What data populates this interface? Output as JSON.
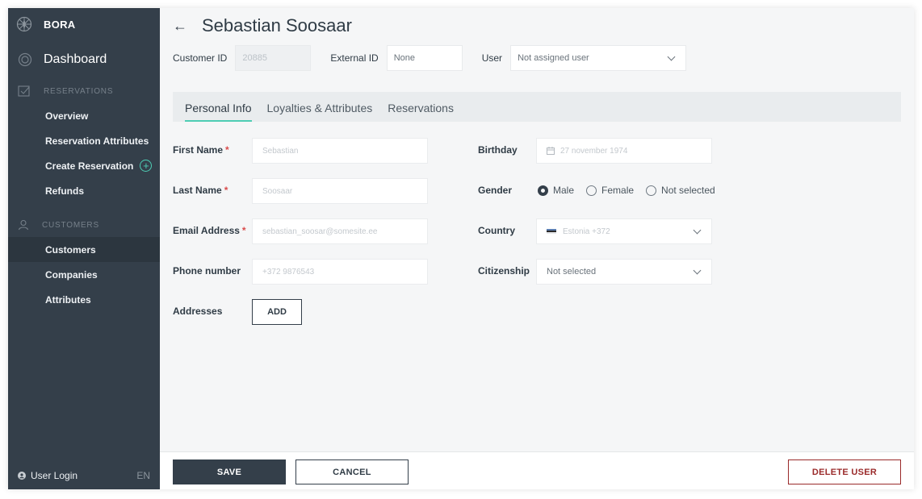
{
  "app": {
    "brand": "BORA"
  },
  "sidebar": {
    "dashboard": "Dashboard",
    "reservations_section": "RESERVATIONS",
    "reservation_items": [
      {
        "label": "Overview"
      },
      {
        "label": "Reservation Attributes"
      },
      {
        "label": "Create Reservation"
      },
      {
        "label": "Refunds"
      }
    ],
    "customers_section": "CUSTOMERS",
    "customer_items": [
      {
        "label": "Customers"
      },
      {
        "label": "Companies"
      },
      {
        "label": "Attributes"
      }
    ],
    "footer": {
      "user_login": "User Login",
      "lang": "EN"
    }
  },
  "header": {
    "title": "Sebastian Soosaar"
  },
  "meta": {
    "customer_id_label": "Customer ID",
    "customer_id_value": "20885",
    "external_id_label": "External ID",
    "external_id_value": "None",
    "user_label": "User",
    "user_value": "Not assigned user"
  },
  "tabs": [
    {
      "label": "Personal Info"
    },
    {
      "label": "Loyalties & Attributes"
    },
    {
      "label": "Reservations"
    }
  ],
  "form": {
    "first_name": {
      "label": "First Name",
      "req": "*",
      "value": "Sebastian"
    },
    "last_name": {
      "label": "Last Name",
      "req": "*",
      "value": "Soosaar"
    },
    "email": {
      "label": "Email Address",
      "req": "*",
      "value": "sebastian_soosar@somesite.ee"
    },
    "phone": {
      "label": "Phone number",
      "value": "+372 9876543"
    },
    "addresses": {
      "label": "Addresses",
      "add_label": "ADD"
    },
    "birthday": {
      "label": "Birthday",
      "value": "27 november 1974"
    },
    "gender": {
      "label": "Gender",
      "options": [
        "Male",
        "Female",
        "Not selected"
      ],
      "selected": "Male"
    },
    "country": {
      "label": "Country",
      "value": "Estonia +372"
    },
    "citizenship": {
      "label": "Citizenship",
      "value": "Not selected"
    }
  },
  "footer": {
    "save": "SAVE",
    "cancel": "CANCEL",
    "delete": "DELETE USER"
  },
  "colors": {
    "sidebar_bg": "#343f4a",
    "accent": "#4ecdb4",
    "danger": "#9a2a2a",
    "required": "#d94b4b"
  }
}
